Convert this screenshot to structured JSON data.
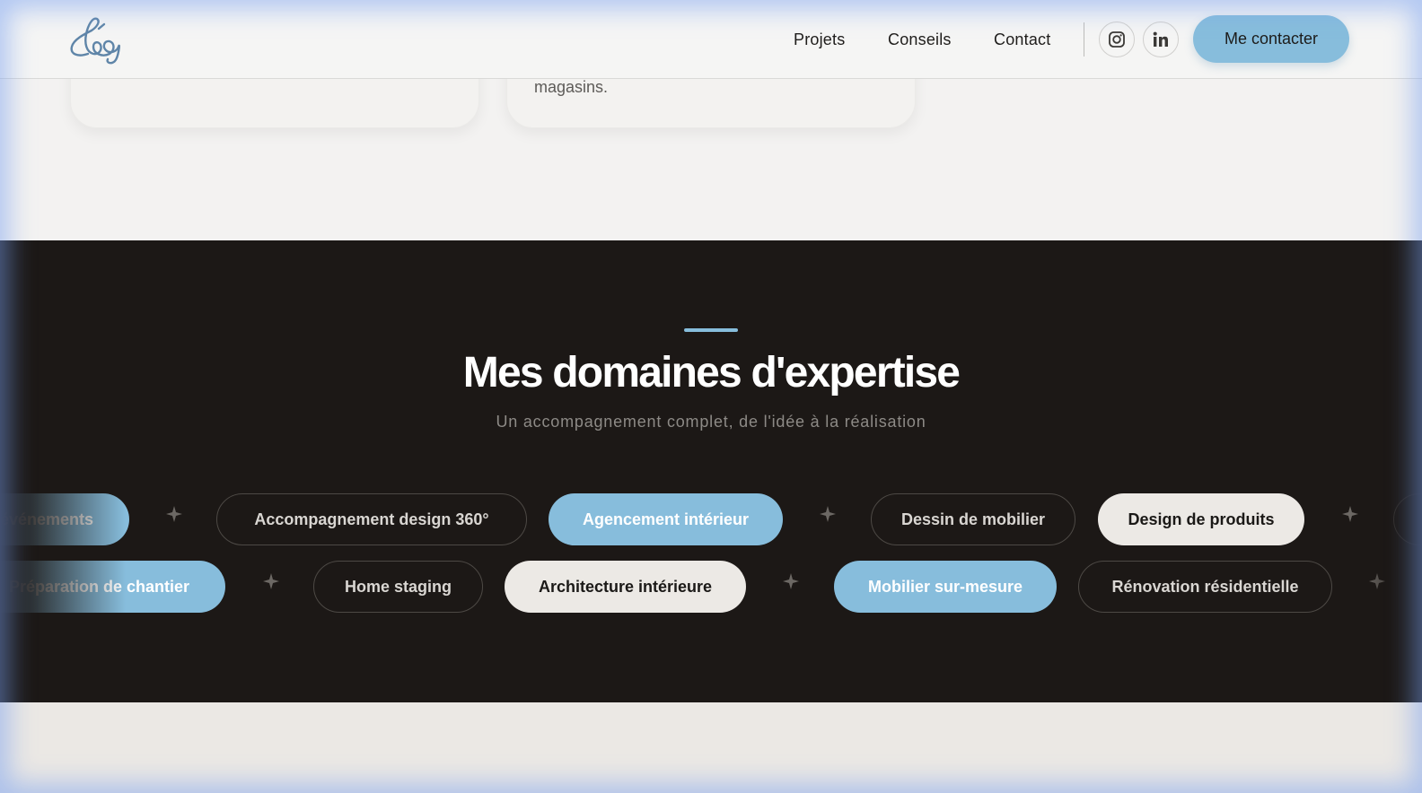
{
  "header": {
    "logo_text": "Léa",
    "nav": [
      {
        "label": "Projets"
      },
      {
        "label": "Conseils"
      },
      {
        "label": "Contact"
      }
    ],
    "social": [
      {
        "icon": "instagram-icon"
      },
      {
        "icon": "linkedin-icon"
      }
    ],
    "cta_label": "Me contacter"
  },
  "cards": {
    "items": [
      {
        "text": ""
      },
      {
        "text": "magasins."
      }
    ]
  },
  "expertise": {
    "title": "Mes domaines d'expertise",
    "subtitle": "Un accompagnement complet, de l'idée à la réalisation",
    "row1": [
      {
        "label": "événements",
        "style": "blue"
      },
      {
        "label": "Accompagnement design 360°",
        "style": "outline"
      },
      {
        "label": "Agencement intérieur",
        "style": "blue"
      },
      {
        "label": "Dessin de mobilier",
        "style": "outline"
      },
      {
        "label": "Design de produits",
        "style": "light"
      }
    ],
    "row2": [
      {
        "label": "Préparation de chantier",
        "style": "blue"
      },
      {
        "label": "Home staging",
        "style": "outline"
      },
      {
        "label": "Architecture intérieure",
        "style": "light"
      },
      {
        "label": "Mobilier sur-mesure",
        "style": "blue"
      },
      {
        "label": "Rénovation résidentielle",
        "style": "outline"
      }
    ]
  },
  "colors": {
    "accent": "#87bddc",
    "dark_bg": "#1c1816",
    "light_bg": "#f3f2f1",
    "pill_light": "#ece9e5"
  }
}
